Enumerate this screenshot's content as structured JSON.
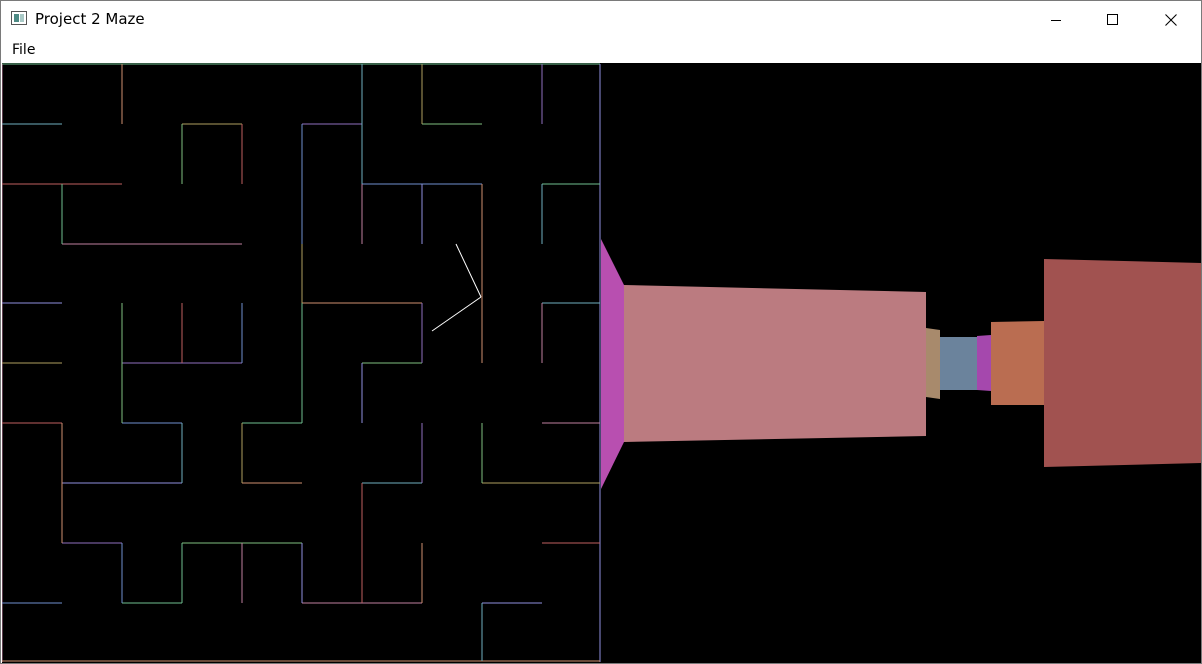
{
  "window": {
    "title": "Project 2 Maze",
    "controls": {
      "minimize_icon": "minimize-icon",
      "maximize_icon": "maximize-icon",
      "close_icon": "close-icon"
    }
  },
  "menu": {
    "items": [
      {
        "label": "File"
      }
    ]
  },
  "colors": {
    "background": "#000000",
    "viewer_line": "#ffffff",
    "wall_colors": [
      "#b84fb0",
      "#bb7b80",
      "#a88a6c",
      "#6b839c",
      "#a548ad",
      "#ba6d51",
      "#a15250"
    ]
  }
}
